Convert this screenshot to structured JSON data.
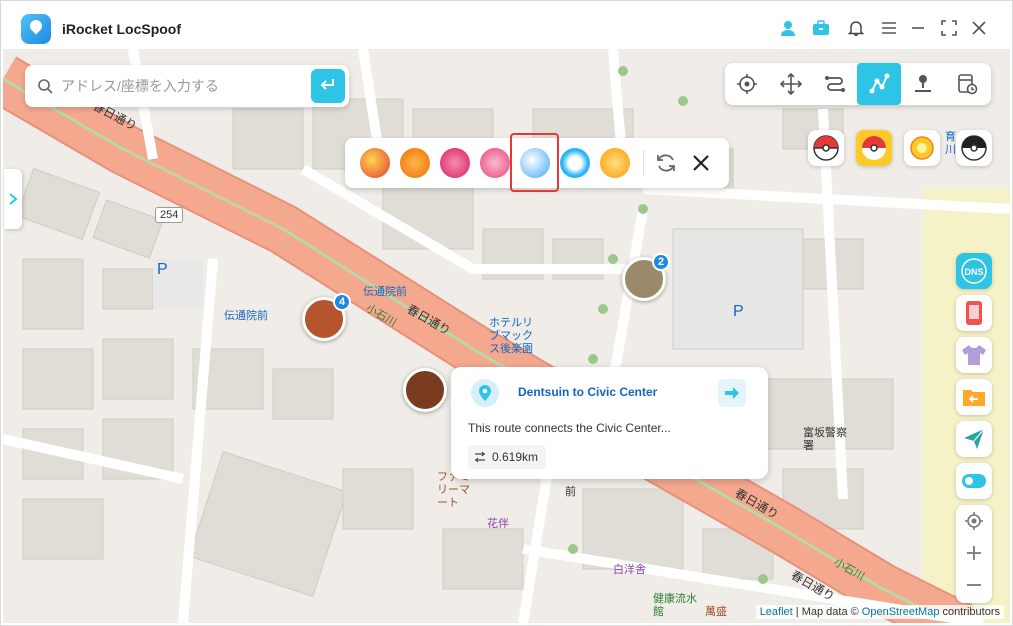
{
  "app": {
    "title": "iRocket LocSpoof"
  },
  "titlebar": {
    "icons": [
      "user-icon",
      "toolbox-icon",
      "bell-icon",
      "menu-icon",
      "minimize-icon",
      "fullscreen-icon",
      "close-icon"
    ]
  },
  "search": {
    "placeholder": "アドレス/座標を入力する",
    "value": ""
  },
  "modes": {
    "items": [
      "teleport-mode",
      "joystick-mode",
      "two-spot-mode",
      "multi-spot-mode",
      "jump-teleport-mode",
      "history"
    ],
    "active": "multi-spot-mode"
  },
  "popup": {
    "title": "Dentsuin to Civic Center",
    "description": "This route connects the Civic Center...",
    "distance": "0.619km"
  },
  "markers": [
    {
      "badge": "4"
    },
    {
      "badge": "2"
    }
  ],
  "map_labels": {
    "road1": "春日通り",
    "road2": "春日通り",
    "road3": "春日通り",
    "road4": "春日通り",
    "route254": "254",
    "bus1": "伝通院前",
    "bus2": "伝通院前",
    "hotel": "ホテルリブマックス後楽園",
    "koishikawa1": "小石川",
    "koishikawa2": "小石川",
    "police": "富坂警察署",
    "family": "ファミリーマート",
    "hana": "花伴",
    "shiro": "白洋舎",
    "kenko": "健康流水館",
    "mansei": "萬盛",
    "mae": "前",
    "parking1": "P",
    "parking2": "P",
    "corner": "育川"
  },
  "attribution": {
    "leaflet": "Leaflet",
    "text": "| Map data ©",
    "osm": "OpenStreetMap",
    "suffix": "contributors"
  },
  "colors": {
    "accent": "#2ec4e6",
    "road": "#f4a98f",
    "selected_border": "#e53935"
  }
}
